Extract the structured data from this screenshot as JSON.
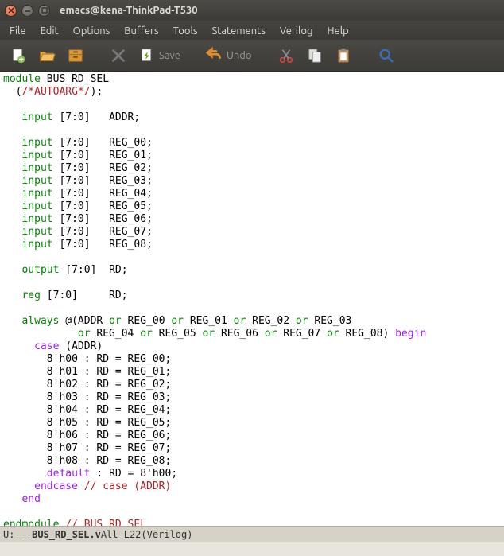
{
  "window": {
    "title": "emacs@kena-ThinkPad-T530"
  },
  "menu": {
    "items": [
      "File",
      "Edit",
      "Options",
      "Buffers",
      "Tools",
      "Statements",
      "Verilog",
      "Help"
    ]
  },
  "toolbar": {
    "save_label": "Save",
    "undo_label": "Undo"
  },
  "modeline": {
    "left": "U:---  ",
    "filename": "BUS_RD_SEL.v",
    "pos": "   All L22    ",
    "mode": "(Verilog)"
  },
  "code": {
    "tokens": [
      [
        "kw",
        "module"
      ],
      [
        "",
        " BUS_RD_SEL\n"
      ],
      [
        "",
        "  ("
      ],
      [
        "star",
        "/*"
      ],
      [
        "autoarg",
        "AUTOARG"
      ],
      [
        "star",
        "*/"
      ],
      [
        "",
        ");\n"
      ],
      [
        "",
        "\n"
      ],
      [
        "",
        "   "
      ],
      [
        "type",
        "input"
      ],
      [
        "",
        " [7:0]   ADDR;\n"
      ],
      [
        "",
        "\n"
      ],
      [
        "",
        "   "
      ],
      [
        "type",
        "input"
      ],
      [
        "",
        " [7:0]   REG_00;\n"
      ],
      [
        "",
        "   "
      ],
      [
        "type",
        "input"
      ],
      [
        "",
        " [7:0]   REG_01;\n"
      ],
      [
        "",
        "   "
      ],
      [
        "type",
        "input"
      ],
      [
        "",
        " [7:0]   REG_02;\n"
      ],
      [
        "",
        "   "
      ],
      [
        "type",
        "input"
      ],
      [
        "",
        " [7:0]   REG_03;\n"
      ],
      [
        "",
        "   "
      ],
      [
        "type",
        "input"
      ],
      [
        "",
        " [7:0]   REG_04;\n"
      ],
      [
        "",
        "   "
      ],
      [
        "type",
        "input"
      ],
      [
        "",
        " [7:0]   REG_05;\n"
      ],
      [
        "",
        "   "
      ],
      [
        "type",
        "input"
      ],
      [
        "",
        " [7:0]   REG_06;\n"
      ],
      [
        "",
        "   "
      ],
      [
        "type",
        "input"
      ],
      [
        "",
        " [7:0]   REG_07;\n"
      ],
      [
        "",
        "   "
      ],
      [
        "type",
        "input"
      ],
      [
        "",
        " [7:0]   REG_08;\n"
      ],
      [
        "",
        "\n"
      ],
      [
        "",
        "   "
      ],
      [
        "type",
        "output"
      ],
      [
        "",
        " [7:0]  RD;\n"
      ],
      [
        "",
        "\n"
      ],
      [
        "",
        "   "
      ],
      [
        "type",
        "reg"
      ],
      [
        "",
        " [7:0]     RD;\n"
      ],
      [
        "",
        "\n"
      ],
      [
        "",
        "   "
      ],
      [
        "kw",
        "always"
      ],
      [
        "",
        " @(ADDR "
      ],
      [
        "kw",
        "or"
      ],
      [
        "",
        " REG_00 "
      ],
      [
        "kw",
        "or"
      ],
      [
        "",
        " REG_01 "
      ],
      [
        "kw",
        "or"
      ],
      [
        "",
        " REG_02 "
      ],
      [
        "kw",
        "or"
      ],
      [
        "",
        " REG_03\n"
      ],
      [
        "",
        "            "
      ],
      [
        "kw",
        "or"
      ],
      [
        "",
        " REG_04 "
      ],
      [
        "kw",
        "or"
      ],
      [
        "",
        " REG_05 "
      ],
      [
        "kw",
        "or"
      ],
      [
        "",
        " REG_06 "
      ],
      [
        "kw",
        "or"
      ],
      [
        "",
        " REG_07 "
      ],
      [
        "kw",
        "or"
      ],
      [
        "",
        " REG_08) "
      ],
      [
        "begin",
        "begin"
      ],
      [
        "",
        "\n"
      ],
      [
        "",
        "     "
      ],
      [
        "begin",
        "case"
      ],
      [
        "",
        " (ADDR)\n"
      ],
      [
        "",
        "       8'h00 : RD = REG_00;\n"
      ],
      [
        "",
        "       8'h01 : RD = REG_01;\n"
      ],
      [
        "",
        "       8'h02 : RD = REG_02;\n"
      ],
      [
        "",
        "       8'h03 : RD = REG_03;\n"
      ],
      [
        "",
        "       8'h04 : RD = REG_04;\n"
      ],
      [
        "",
        "       8'h05 : RD = REG_05;\n"
      ],
      [
        "",
        "       8'h06 : RD = REG_06;\n"
      ],
      [
        "",
        "       8'h07 : RD = REG_07;\n"
      ],
      [
        "",
        "       8'h08 : RD = REG_08;\n"
      ],
      [
        "",
        "       "
      ],
      [
        "begin",
        "default"
      ],
      [
        "",
        " : RD = 8'h00;\n"
      ],
      [
        "",
        "     "
      ],
      [
        "begin",
        "endcase"
      ],
      [
        "",
        " "
      ],
      [
        "comment",
        "// case (ADDR)"
      ],
      [
        "",
        "\n"
      ],
      [
        "",
        "   "
      ],
      [
        "begin",
        "end"
      ],
      [
        "",
        "\n"
      ],
      [
        "",
        "\n"
      ],
      [
        "kw",
        "endmodule"
      ],
      [
        "",
        " "
      ],
      [
        "comment",
        "// BUS_RD_SEL"
      ],
      [
        "",
        "\n"
      ]
    ]
  }
}
